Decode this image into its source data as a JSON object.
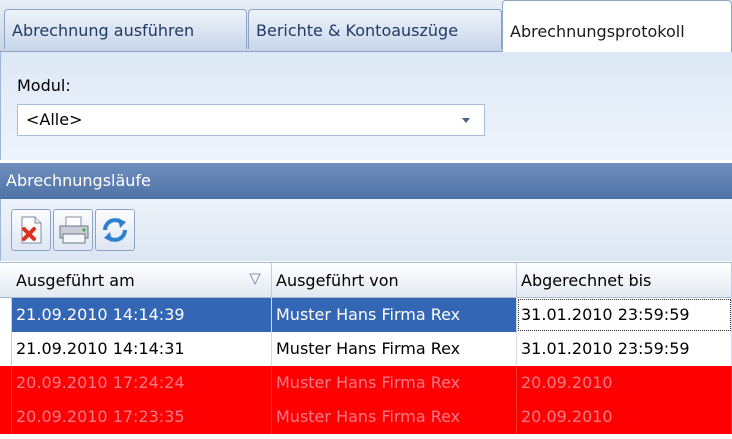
{
  "tabs": [
    {
      "label": "Abrechnung ausführen",
      "active": false
    },
    {
      "label": "Berichte & Kontoauszüge",
      "active": false
    },
    {
      "label": "Abrechnungsprotokoll",
      "active": true
    }
  ],
  "module": {
    "label": "Modul:",
    "selected": "<Alle>"
  },
  "section": {
    "title": "Abrechnungsläufe"
  },
  "toolbar": {
    "buttons": [
      {
        "name": "delete",
        "icon": "delete-icon"
      },
      {
        "name": "print",
        "icon": "printer-icon"
      },
      {
        "name": "refresh",
        "icon": "refresh-icon"
      }
    ]
  },
  "grid": {
    "columns": [
      "Ausgeführt am",
      "Ausgeführt von",
      "Abgerechnet bis"
    ],
    "sort": {
      "column": "Ausgeführt am",
      "direction": "descending"
    },
    "rows": [
      {
        "executed_at": "21.09.2010 14:14:39",
        "executed_by": "Muster Hans Firma Rex",
        "billed_until": "31.01.2010 23:59:59",
        "state": "selected"
      },
      {
        "executed_at": "21.09.2010 14:14:31",
        "executed_by": "Muster Hans Firma Rex",
        "billed_until": "31.01.2010 23:59:59",
        "state": "normal"
      },
      {
        "executed_at": "20.09.2010 17:24:24",
        "executed_by": "Muster Hans Firma Rex",
        "billed_until": "20.09.2010",
        "state": "error"
      },
      {
        "executed_at": "20.09.2010 17:23:35",
        "executed_by": "Muster Hans Firma Rex",
        "billed_until": "20.09.2010",
        "state": "error"
      }
    ]
  },
  "colors": {
    "selected_row": "#3366b5",
    "error_row": "#ff0000",
    "error_text": "#f27a8a",
    "section_header": "#5a7cb0"
  }
}
